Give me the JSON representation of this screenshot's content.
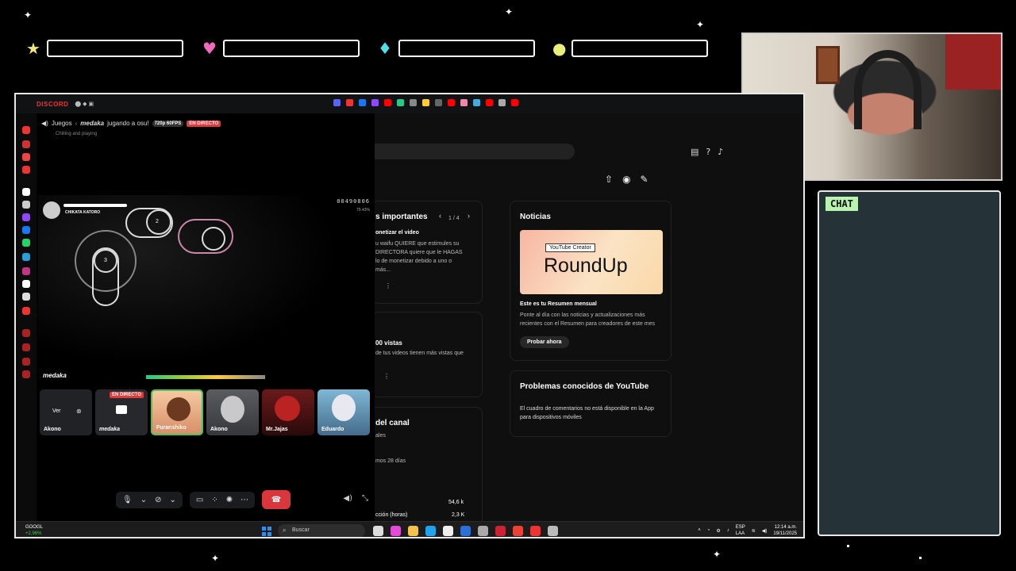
{
  "discord": {
    "brand": "DISCORD",
    "channel": "Juegos",
    "stream_title": "jugando a osu!",
    "streamer_name": "medaka",
    "quality": "720p 60FPS",
    "live_badge": "EN DIRECTO",
    "status_text": "Chilling and playing",
    "game": {
      "score": "00490806",
      "accuracy": "79.43%",
      "player": "CHIKATA KATORO",
      "circle_numbers": [
        "2",
        "3"
      ]
    },
    "participants": [
      {
        "name": "Akono",
        "type": "view",
        "view_label": "Ver"
      },
      {
        "name": "medaka",
        "type": "live"
      },
      {
        "name": "Furanshiko",
        "type": "cam"
      },
      {
        "name": "Akono",
        "type": "cam"
      },
      {
        "name": "Mr.Jajas",
        "type": "cam"
      },
      {
        "name": "Eduardo",
        "type": "cam"
      }
    ]
  },
  "youtube": {
    "important_card": {
      "title": "s importantes",
      "pager": "1 / 4",
      "item_title": "onetizar el video",
      "item_body": "u waifu QUIERE que estimules su DIRECTORA quiere que le HAGAS lo de monetizar debido a uno o más..."
    },
    "views_card": {
      "title": "00 vistas",
      "body": "de tus videos tienen más vistas que"
    },
    "channel_card": {
      "title": "del canal",
      "subtitle": "ales",
      "period": "mos 28 días",
      "stat1": "54,6 k",
      "stat2_label": "cción (horas)",
      "stat2": "2,3 K"
    },
    "news_card": {
      "title": "Noticias",
      "banner_tag": "YouTube Creator",
      "banner_word": "RoundUp",
      "headline": "Este es tu Resumen mensual",
      "body": "Ponte al día con las noticias y actualizaciones más recientes con el Resumen para creadores de este mes",
      "button": "Probar ahora"
    },
    "problems_card": {
      "title": "Problemas conocidos de YouTube",
      "body": "El cuadro de comentarios no está disponible en la App para dispositivos móviles"
    }
  },
  "taskbar": {
    "stock_name": "GOOGL",
    "stock_change": "+2,96%",
    "search_label": "Buscar",
    "lang": "ESP",
    "lang2": "LAA",
    "time": "12:14 a.m.",
    "date": "19/11/2025"
  },
  "chat": {
    "label": "CHAT"
  },
  "colors": {
    "accent_live": "#e03a3a",
    "chat_label_bg": "#b9f3b0",
    "chat_bg": "#253238",
    "end_call": "#da373c"
  }
}
